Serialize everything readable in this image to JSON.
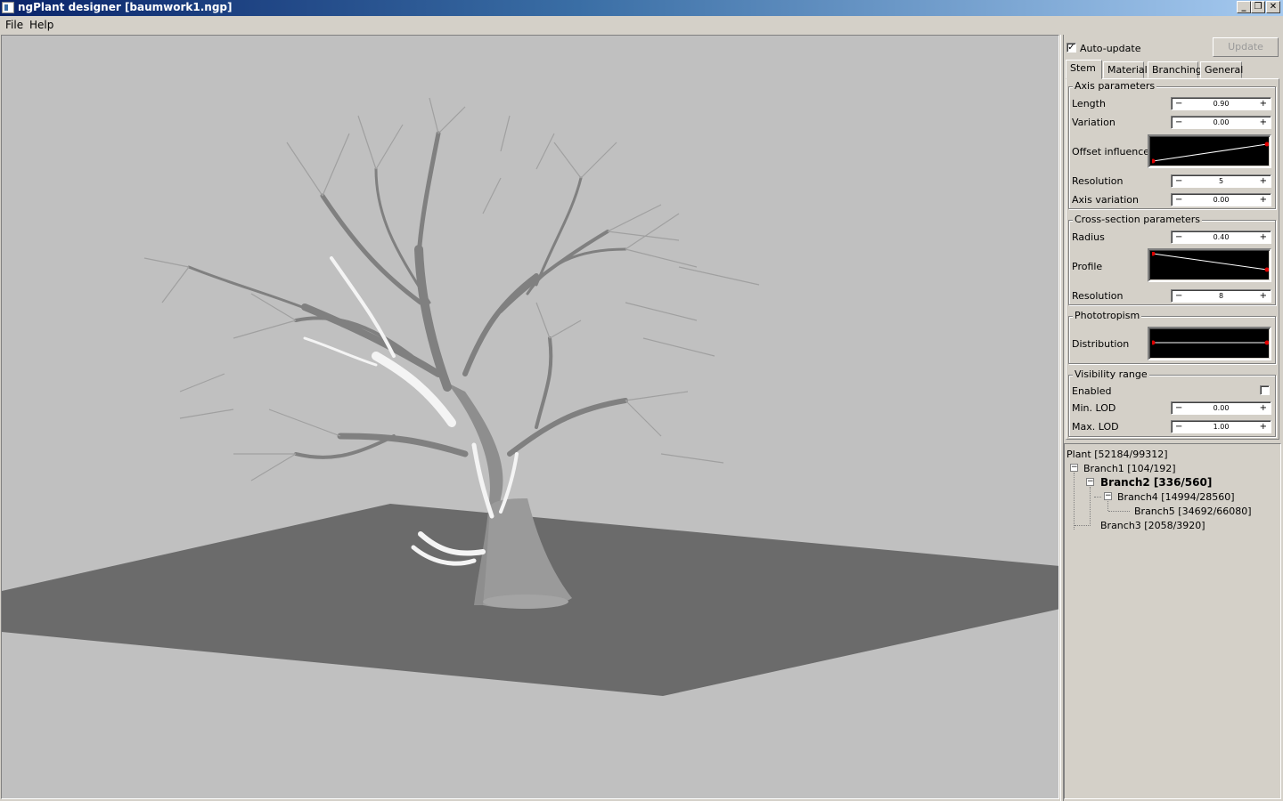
{
  "window": {
    "title": "ngPlant designer [baumwork1.ngp]"
  },
  "menu": {
    "items": [
      "File",
      "Help"
    ]
  },
  "controls": {
    "auto_update_label": "Auto-update",
    "auto_update_checked": true,
    "update_label": "Update"
  },
  "tabs": [
    "Stem",
    "Material",
    "Branching",
    "General"
  ],
  "axis_parameters": {
    "title": "Axis parameters",
    "length_label": "Length",
    "length_value": "0.90",
    "variation_label": "Variation",
    "variation_value": "0.00",
    "offset_influence_label": "Offset influence",
    "resolution_label": "Resolution",
    "resolution_value": "5",
    "axis_variation_label": "Axis variation",
    "axis_variation_value": "0.00"
  },
  "cross_section": {
    "title": "Cross-section parameters",
    "radius_label": "Radius",
    "radius_value": "0.40",
    "profile_label": "Profile",
    "resolution_label": "Resolution",
    "resolution_value": "8"
  },
  "phototropism": {
    "title": "Phototropism",
    "distribution_label": "Distribution"
  },
  "visibility": {
    "title": "Visibility range",
    "enabled_label": "Enabled",
    "enabled_checked": false,
    "min_lod_label": "Min. LOD",
    "min_lod_value": "0.00",
    "max_lod_label": "Max. LOD",
    "max_lod_value": "1.00"
  },
  "spin_symbols": {
    "minus": "−",
    "plus": "+"
  },
  "tree": {
    "nodes": [
      {
        "label": "Plant [52184/99312]",
        "bold": false
      },
      {
        "label": "Branch1 [104/192]",
        "bold": false
      },
      {
        "label": "Branch2 [336/560]",
        "bold": true
      },
      {
        "label": "Branch4 [14994/28560]",
        "bold": false
      },
      {
        "label": "Branch5 [34692/66080]",
        "bold": false
      },
      {
        "label": "Branch3 [2058/3920]",
        "bold": false
      }
    ]
  },
  "icons": [
    "app-icon",
    "minimize-icon",
    "restore-icon",
    "close-icon",
    "checkmark-icon",
    "expander-minus-icon"
  ]
}
